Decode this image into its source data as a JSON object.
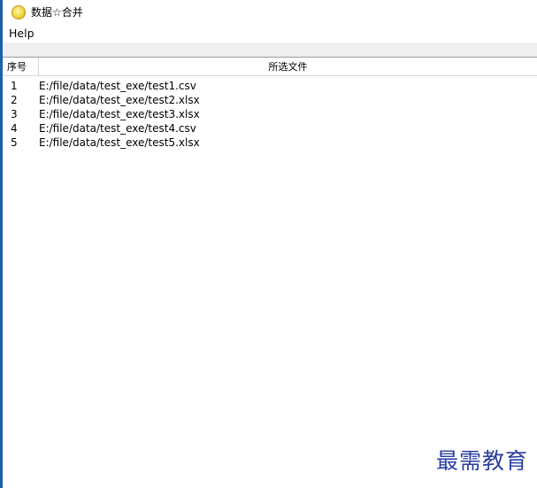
{
  "window": {
    "title": "数据☆合并",
    "icon": "app-icon"
  },
  "menu": {
    "items": [
      "Help"
    ]
  },
  "table": {
    "headers": {
      "index": "序号",
      "file": "所选文件"
    },
    "rows": [
      {
        "index": "1",
        "file": "E:/file/data/test_exe/test1.csv"
      },
      {
        "index": "2",
        "file": "E:/file/data/test_exe/test2.xlsx"
      },
      {
        "index": "3",
        "file": "E:/file/data/test_exe/test3.xlsx"
      },
      {
        "index": "4",
        "file": "E:/file/data/test_exe/test4.csv"
      },
      {
        "index": "5",
        "file": "E:/file/data/test_exe/test5.xlsx"
      }
    ]
  },
  "watermark": "最需教育",
  "colors": {
    "window_edge": "#1f5fa8",
    "watermark": "#2a3fa0",
    "toolbar_bg": "#f0f0f0"
  }
}
